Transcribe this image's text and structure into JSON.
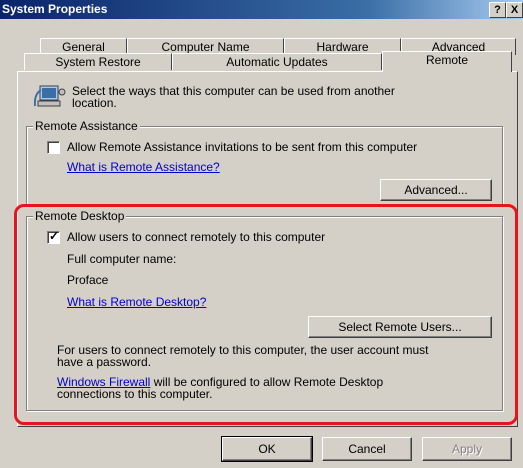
{
  "window": {
    "title": "System Properties",
    "help_button": "?",
    "close_button": "X"
  },
  "tabs": {
    "row1": [
      "General",
      "Computer Name",
      "Hardware",
      "Advanced"
    ],
    "row2": [
      "System Restore",
      "Automatic Updates",
      "Remote"
    ],
    "active": "Remote"
  },
  "remote": {
    "intro": "Select the ways that this computer can be used from another",
    "intro_line2": "location.",
    "assistance": {
      "group_label": "Remote Assistance",
      "checkbox_label": "Allow Remote Assistance invitations to be sent from this computer",
      "checked": false,
      "link": "What is Remote Assistance?",
      "advanced_button": "Advanced..."
    },
    "desktop": {
      "group_label": "Remote Desktop",
      "checkbox_label": "Allow users to connect remotely to this computer",
      "checked": true,
      "full_name_label": "Full computer name:",
      "computer_name": "Proface",
      "link": "What is Remote Desktop?",
      "select_users_button": "Select Remote Users...",
      "password_note_1": "For users to connect remotely to this computer, the user account must",
      "password_note_2": "have a password.",
      "firewall_link": "Windows Firewall",
      "firewall_text": " will be configured to allow Remote Desktop",
      "firewall_text_2": "connections to this computer."
    }
  },
  "buttons": {
    "ok": "OK",
    "cancel": "Cancel",
    "apply": "Apply"
  },
  "colors": {
    "highlight_border": "#e8141c",
    "title_bar": "#0a246a",
    "link": "#0000cc"
  }
}
